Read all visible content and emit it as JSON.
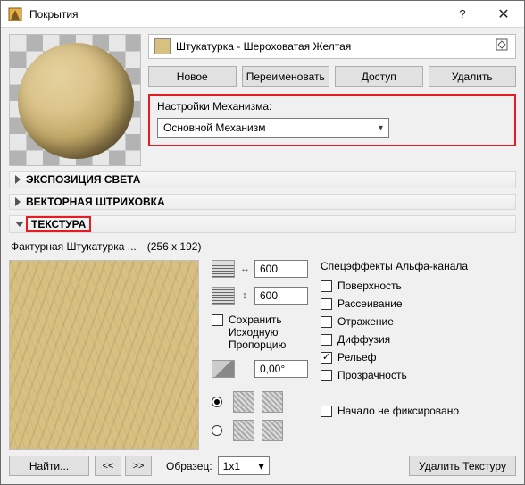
{
  "window": {
    "title": "Покрытия"
  },
  "header": {
    "material_name": "Штукатурка - Шероховатая Желтая",
    "buttons": {
      "new": "Новое",
      "rename": "Переименовать",
      "access": "Доступ",
      "delete": "Удалить"
    }
  },
  "engine": {
    "label": "Настройки Механизма:",
    "value": "Основной Механизм"
  },
  "sections": {
    "exposure": "ЭКСПОЗИЦИЯ СВЕТА",
    "hatch": "ВЕКТОРНАЯ ШТРИХОВКА",
    "texture": "ТЕКСТУРА"
  },
  "texture": {
    "name": "Фактурная Штукатурка ...",
    "dims": "(256 x 192)",
    "width": "600",
    "height": "600",
    "keep_ratio": "Сохранить Исходную Пропорцию",
    "angle": "0,00°"
  },
  "fx": {
    "title": "Спецэффекты Альфа-канала",
    "surface": "Поверхность",
    "diffusion": "Рассеивание",
    "reflection": "Отражение",
    "diffuse": "Диффузия",
    "relief": "Рельеф",
    "transparency": "Прозрачность",
    "origin": "Начало не фиксировано"
  },
  "footer": {
    "find": "Найти...",
    "prev": "<<",
    "next": ">>",
    "sample_label": "Образец:",
    "sample_value": "1x1",
    "delete_texture": "Удалить Текстуру"
  }
}
